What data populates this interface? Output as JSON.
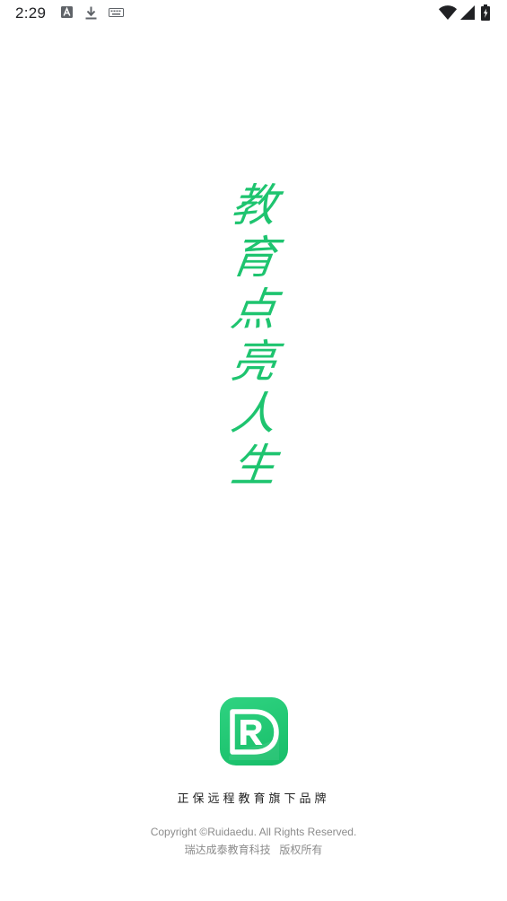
{
  "status_bar": {
    "time": "2:29",
    "icons": [
      "app-a-icon",
      "download-icon",
      "keyboard-icon",
      "wifi-icon",
      "cell-signal-icon",
      "battery-charging-icon"
    ]
  },
  "splash": {
    "slogan_chars": [
      "教",
      "育",
      "点",
      "亮",
      "人",
      "生"
    ],
    "slogan_color": "#1ec46f",
    "logo_icon": "ruida-rd-logo",
    "logo_color": "#1fc66f",
    "brand_line": "正保远程教育旗下品牌",
    "copyright_en": "Copyright ©Ruidaedu. All Rights Reserved.",
    "copyright_cn": "瑞达成泰教育科技 版权所有"
  }
}
